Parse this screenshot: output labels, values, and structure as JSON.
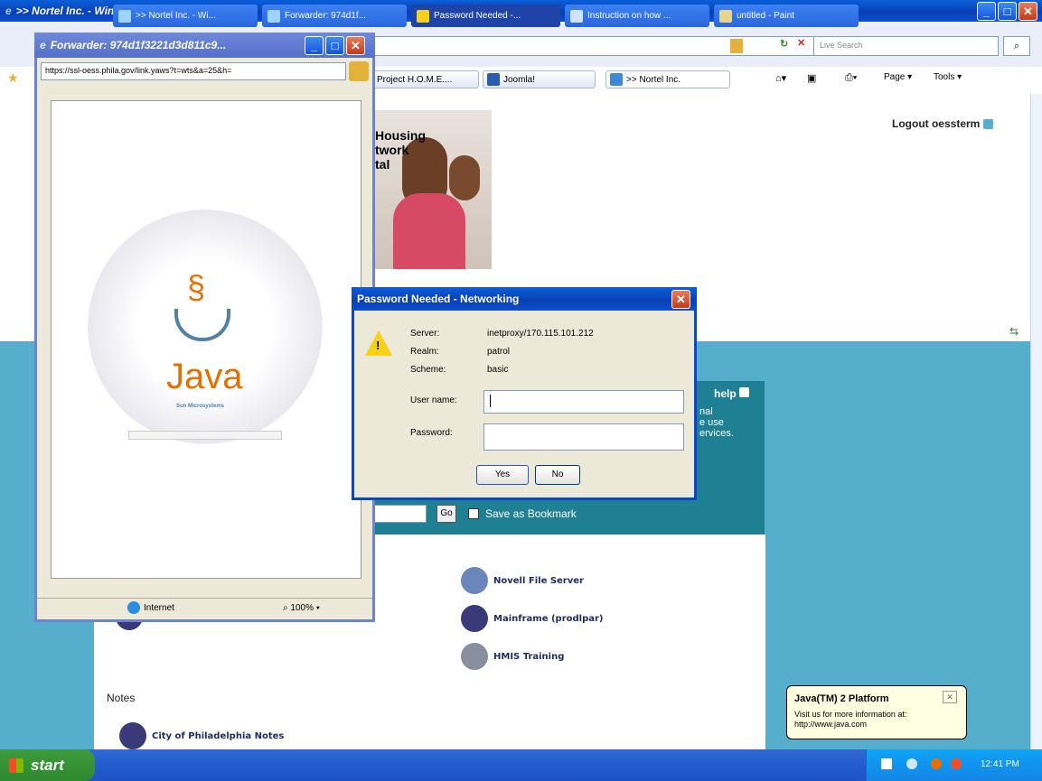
{
  "ie": {
    "title": ">> Nortel Inc. - Windows Internet Explorer",
    "search_placeholder": "Live Search",
    "favorites": [
      "Project H.O.M.E....",
      "Joomla!"
    ],
    "tab_label": ">> Nortel Inc.",
    "toolbar": {
      "page": "Page",
      "tools": "Tools"
    }
  },
  "page": {
    "header_lines": [
      "Housing",
      "twork",
      "tal"
    ],
    "logout": "Logout oessterm",
    "help": "help",
    "help_text": [
      "nal",
      "e use",
      "ervices."
    ],
    "go_button": "Go",
    "save_bookmark": "Save as Bookmark",
    "links": [
      "Novell File Server",
      "Mainframe (prodlpar)",
      "HMIS Training"
    ],
    "notes_heading": "Notes",
    "notes_link": "City of Philadelphia Notes"
  },
  "forwarder": {
    "title": "Forwarder: 974d1f3221d3d811c9...",
    "url": "https://ssl-oess.phila.gov/link.yaws?t=wts&a=25&h=",
    "java_label": "Java",
    "java_sub": "Sun Microsystems",
    "status_zone": "Internet",
    "zoom": "100%"
  },
  "dialog": {
    "title": "Password Needed - Networking",
    "server_label": "Server:",
    "server_value": "inetproxy/170.115.101.212",
    "realm_label": "Realm:",
    "realm_value": "patrol",
    "scheme_label": "Scheme:",
    "scheme_value": "basic",
    "user_label": "User name:",
    "password_label": "Password:",
    "yes": "Yes",
    "no": "No"
  },
  "balloon": {
    "title": "Java(TM) 2 Platform",
    "body": "Visit us for more information at: http://www.java.com"
  },
  "taskbar": {
    "start": "start",
    "tasks": [
      ">> Nortel Inc. - Wi...",
      "Forwarder: 974d1f...",
      "Password Needed -...",
      "Instruction on how ...",
      "untitled - Paint"
    ],
    "clock": "12:41 PM"
  },
  "colors": {
    "title_blue": "#0a46c8",
    "teal": "#55aecb",
    "java_red": "#e76f00",
    "taskbar": "#245ecf"
  }
}
